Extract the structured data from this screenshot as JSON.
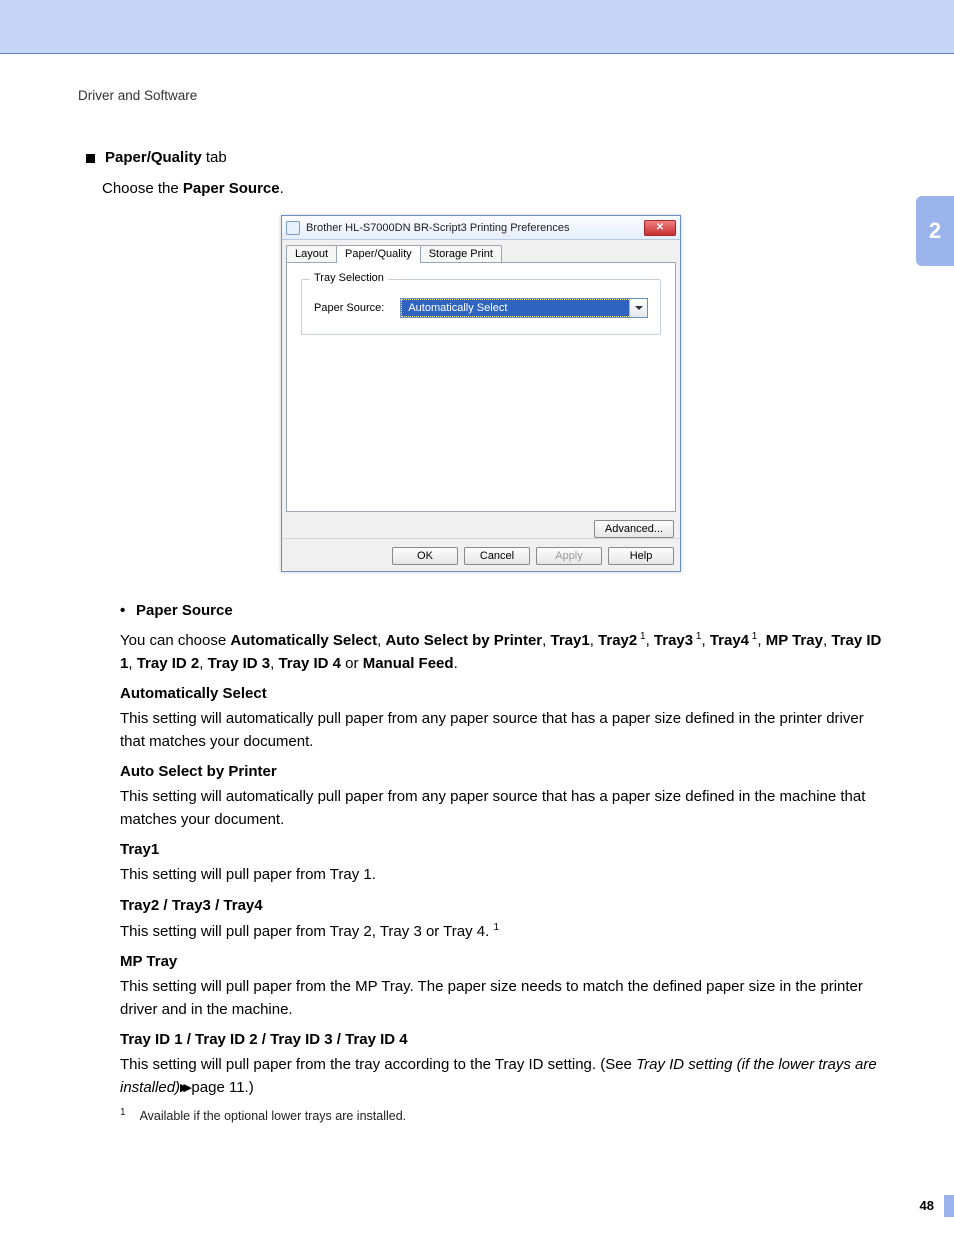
{
  "breadcrumb": "Driver and Software",
  "chapter_number": "2",
  "h_tab": {
    "prefix": "Paper/Quality",
    "suffix": " tab"
  },
  "choose_line": {
    "pre": "Choose the ",
    "bold": "Paper Source",
    "post": "."
  },
  "dialog": {
    "title": "Brother HL-S7000DN BR-Script3 Printing Preferences",
    "tabs": {
      "layout": "Layout",
      "paper_quality": "Paper/Quality",
      "storage": "Storage Print"
    },
    "group_legend": "Tray Selection",
    "field_label": "Paper Source:",
    "select_value": "Automatically Select",
    "advanced": "Advanced...",
    "ok": "OK",
    "cancel": "Cancel",
    "apply": "Apply",
    "help": "Help"
  },
  "ps_heading": "Paper Source",
  "ps_intro": {
    "p1": "You can choose ",
    "b1": "Automatically Select",
    "c1": ", ",
    "b2": "Auto Select by Printer",
    "c2": ", ",
    "b3": "Tray1",
    "c3": ", ",
    "b4": "Tray2",
    "s4": " 1",
    "c4": ", ",
    "b5": "Tray3",
    "s5": " 1",
    "c5": ", ",
    "b6": "Tray4",
    "s6": " 1",
    "c6": ", ",
    "b7": "MP Tray",
    "c7": ", ",
    "b8": "Tray ID 1",
    "c8": ", ",
    "b9": "Tray ID 2",
    "c9": ", ",
    "b10": "Tray ID 3",
    "c10": ", ",
    "b11": "Tray ID 4",
    "or": " or ",
    "b12": "Manual Feed",
    "end": "."
  },
  "sections": {
    "auto_sel": {
      "h": "Automatically Select",
      "d": "This setting will automatically pull paper from any paper source that has a paper size defined in the printer driver that matches your document."
    },
    "auto_prn": {
      "h": "Auto Select by Printer",
      "d": "This setting will automatically pull paper from any paper source that has a paper size defined in the machine that matches your document."
    },
    "tray1": {
      "h": "Tray1",
      "d": "This setting will pull paper from Tray 1."
    },
    "tray234": {
      "h": "Tray2 / Tray3 / Tray4",
      "d": "This setting will pull paper from Tray 2, Tray 3 or Tray 4. ",
      "sup": "1"
    },
    "mp": {
      "h": "MP Tray",
      "d": "This setting will pull paper from the MP Tray. The paper size needs to match the defined paper size in the printer driver and in the machine."
    },
    "trayid": {
      "h": "Tray ID 1 / Tray ID 2 / Tray ID 3 / Tray ID 4",
      "d1": "This setting will pull paper from the tray according to the Tray ID setting. (See ",
      "ref": "Tray ID setting (if the lower trays are installed)",
      "arrows": " ▸▸",
      "d2": " page 11.)"
    }
  },
  "footnote": {
    "num": "1",
    "text": "Available if the optional lower trays are installed."
  },
  "page_number": "48"
}
